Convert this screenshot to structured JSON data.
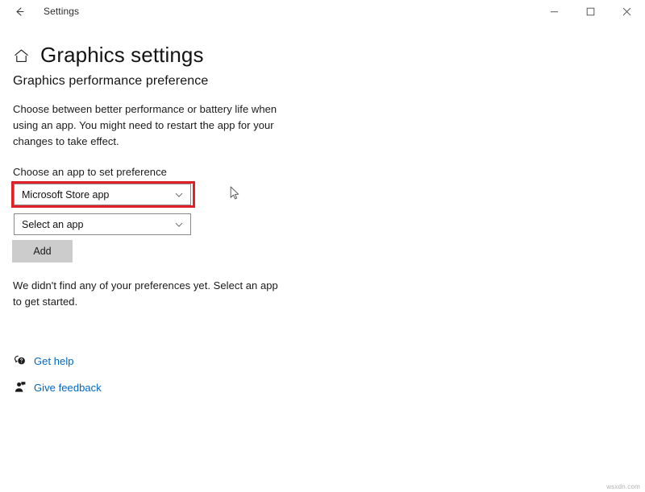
{
  "window": {
    "titlebar_title": "Settings",
    "back_icon": "arrow-left-icon",
    "minimize_label": "Minimize",
    "maximize_label": "Maximize",
    "close_label": "Close"
  },
  "header": {
    "home_icon": "home-icon",
    "page_title": "Graphics settings"
  },
  "main": {
    "section_title": "Graphics performance preference",
    "description": "Choose between better performance or battery life when using an app. You might need to restart the app for your changes to take effect.",
    "field_label": "Choose an app to set preference",
    "app_type_dropdown": {
      "value": "Microsoft Store app",
      "chevron_icon": "chevron-down-icon",
      "highlighted": true
    },
    "app_select_dropdown": {
      "value": "Select an app",
      "chevron_icon": "chevron-down-icon",
      "highlighted": false
    },
    "add_button_label": "Add",
    "empty_state_text": "We didn't find any of your preferences yet. Select an app to get started."
  },
  "footer": {
    "links": [
      {
        "label": "Get help",
        "icon": "help-bubble-icon"
      },
      {
        "label": "Give feedback",
        "icon": "feedback-person-icon"
      }
    ]
  },
  "overlay": {
    "highlight_color": "#e2202a",
    "cursor_icon": "mouse-pointer-icon",
    "watermark": "wsxdn.com"
  }
}
